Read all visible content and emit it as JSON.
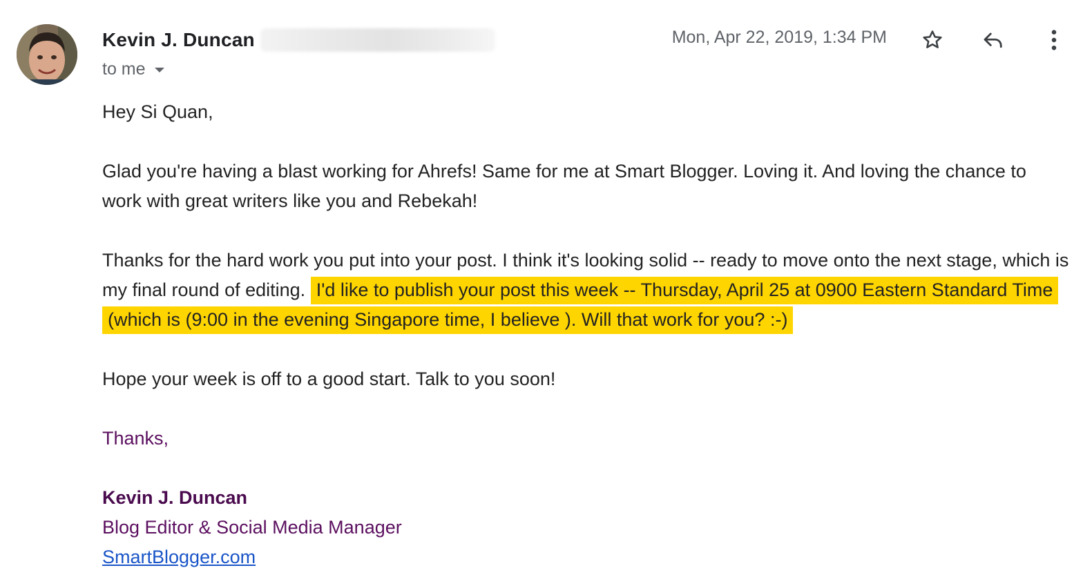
{
  "header": {
    "sender_name": "Kevin J. Duncan",
    "date": "Mon, Apr 22, 2019, 1:34 PM",
    "recipient_label": "to me"
  },
  "icons": {
    "avatar": "sender-avatar",
    "star": "star-icon",
    "reply": "reply-icon",
    "more": "more-vertical-icon",
    "caret": "caret-down-icon"
  },
  "message": {
    "greeting": "Hey Si Quan,",
    "paragraph1": "Glad you're having a blast working for Ahrefs! Same for me at Smart Blogger. Loving it. And loving the chance to work with great writers like you and Rebekah!",
    "paragraph2_plain": "Thanks for the hard work you put into your post. I think it's looking solid -- ready to move onto the next stage, which is my final round of editing.",
    "paragraph2_highlight": "I'd like to publish your post this week -- Thursday, April 25 at 0900 Eastern Standard Time (which is (9:00 in the evening Singapore time, I believe ). Will that work for you? :-)",
    "paragraph3": "Hope your week is off to a good start. Talk to you soon!",
    "closing": "Thanks,"
  },
  "signature": {
    "name": "Kevin J. Duncan",
    "title": "Blog Editor & Social Media Manager",
    "website": "SmartBlogger.com"
  },
  "colors": {
    "highlight": "#ffd500",
    "signature": "#5b0f5f",
    "link": "#1a55c8",
    "meta_gray": "#5f6368"
  }
}
